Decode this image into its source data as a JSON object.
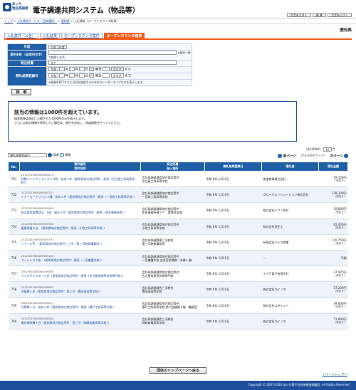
{
  "header": {
    "logo_text_1": "あいち",
    "logo_text_2": "物品等調達",
    "title": "電子調達共同システム（物品等）",
    "font_buttons": [
      "文字を大きく",
      "標 準",
      "文字を小さく"
    ]
  },
  "breadcrumb": {
    "items": [
      "トップ",
      "入札情報サービス（団体選択）",
      "愛知県"
    ],
    "current": "入札情報（オープンカウンタ結果）"
  },
  "prefecture": "愛知県",
  "tabs": [
    "入札案件（公告）",
    "入札結果",
    "オープンカウンタ案件",
    "オープンカウンタ結果"
  ],
  "form": {
    "year_label": "年度",
    "year_value": "令和 5年度",
    "subject_label": "案件名称\n（全角50文字）",
    "subject_note": "※部分一致で検索します。",
    "division_label": "発注所属",
    "division_value": "全て",
    "date_label": "開札結果登録日",
    "date_era": "令和",
    "date_year": "年",
    "date_month": "月",
    "date_day": "日",
    "weekday": "曜日",
    "clear": "クリア",
    "from": "から",
    "to": "まで",
    "date_note": "※画像を押下すると日付を指定するためのカレンダーダイアログを表示します。"
  },
  "search_button": "検　索",
  "message": {
    "title": "該当の情報は1000件を超えています。",
    "line1": "検索結果は直近に公開された1000件のみを表示します。",
    "line2": "さらに以前の情報を参照したい場合は、条件を追加し、再度検索を行ってください。"
  },
  "results": {
    "count_text": "（全1000件）",
    "per_page_value": "10",
    "per_page_suffix": "件",
    "sort_value": "開札結果登録日",
    "asc": "昇順",
    "desc": "降順",
    "prev": "前ページ",
    "page_info": "（76/100ページ）",
    "next": "次ページ",
    "headers": {
      "no": "No.",
      "subject_top": "案件番号",
      "subject_bottom": "案件名称",
      "division_top": "発注所属",
      "division_bottom": "納入場所",
      "date": "開札結果登録日",
      "winner": "落札者",
      "amount": "落札金額"
    },
    "rows": [
      {
        "no": "751",
        "number": "23122523000000005410",
        "name": "同胞バンドアッセンブリ 1個　始め４件（愛知県地方物品等件（尾張（名古屋工科高等学校）〉",
        "division": "会計局調達課県地方物品等件",
        "place": "名古屋工科高等学校",
        "date": "令和 6年 1月10日",
        "winner": "愛進商事株式会社",
        "amount": "19,100円",
        "tax": "（税抜き）"
      },
      {
        "no": "752",
        "number": "23122523000000005221",
        "name": "トナーカートリッジ３種　始め２件（愛知県地方物品等件（尾張（一宮航工科高等学校）〉",
        "division": "会計局調達課県地方物品等件",
        "place": "一宮航工科高等学校",
        "date": "令和 6年 1月10日",
        "winner": "グローバルソリューション株式会社",
        "amount": "129,300円",
        "tax": "（税抜き）"
      },
      {
        "no": "753",
        "number": "23122523000000005454",
        "name": "純水製造装置部品　1個　始め２件（愛知県地方物品等件（尾張（知多事務所等）〉",
        "division": "会計局調達課県地方物品等件",
        "place": "知多事務所棟２Ｆ　環境保全課",
        "date": "令和 6年 1月10日",
        "winner": "株式会社テクノ西村",
        "amount": "39,800円",
        "tax": "（税抜き）"
      },
      {
        "no": "754",
        "number": "23122523000000005944",
        "name": "複層擦器８台　（愛知県地方物品等件：尾張（小牧工科高等学校）〉",
        "division": "会計局調達課県地方物品等件",
        "place": "小牧工科高等学校",
        "date": "令和 6年 1月10日",
        "winner": "株式会社羽生工",
        "amount": "62,400円",
        "tax": "（税抜き）"
      },
      {
        "no": "755",
        "number": "23122323000000005191",
        "name": "トナー５色　〈愛知県地方物品等件：三河（東三河総務事務所）〉",
        "division": "会計局調達課東三河総合",
        "place": "東三河総務事務所",
        "date": "令和 6年 1月10日",
        "winner": "有限会社エテカ商事",
        "amount": "170,750円",
        "tax": "（税抜き）"
      },
      {
        "no": "756",
        "number": "23122223000000005160",
        "name": "マットレス４枚　〈愛知県地方物品等件：尾張（一宮養護学校）〉",
        "division": "会計局調達課県地方物品等件",
        "place": "一宮養護学校\n会合室前通路（本棟１階）",
        "date": "令和 6年 1月10日",
        "winner": "―",
        "amount": "不調",
        "tax": ""
      },
      {
        "no": "757",
        "number": "24010923000000006065",
        "name": "アナログテスター５台〈愛知県地方物品等件：尾張（名古屋南高等技術専門校）〉",
        "division": "会計局調達課県地方物品等件",
        "place": "名古屋南高等技術専門校",
        "date": "令和 6年 1月10日",
        "winner": "テクサ電子有限会社",
        "amount": "37,975円",
        "tax": "（税抜き）"
      },
      {
        "no": "758",
        "number": "23122023000000006497",
        "name": "冷蔵庫１台〈愛知県地方物品等件：西三河（豊田東高等学校）〉",
        "division": "会計局調達課西三河総合",
        "place": "豊田東高等学校",
        "date": "令和 6年 1月10日",
        "winner": "株式会社カイノス",
        "amount": "57,200円",
        "tax": "（税抜き）"
      },
      {
        "no": "759",
        "number": "24010923000000006019",
        "name": "冷蔵庫１台　始め２件〈愛知県地方物品等件：尾張（瀬戸工科高等学校）〉",
        "division": "会計局調達課県地方物品等件",
        "place": "瀬戸工科高等学校\n第二会議棟１階　職員室",
        "date": "令和 6年 1月10日",
        "winner": "株式会社ユタイジー",
        "amount": "39,400円",
        "tax": "（税抜き）"
      },
      {
        "no": "760",
        "number": "23122723000000006293",
        "name": "電気掃除機１台〈愛知県地方物品等件：西三河（岡崎商業高等学校）〉",
        "division": "会計局調達課西三河総合",
        "place": "岡崎商業高等学校",
        "date": "令和 6年 1月10日",
        "winner": "株式会社カイノス",
        "amount": "71,800円",
        "tax": "（税抜き）"
      }
    ]
  },
  "top_button": "団体のトップページへ戻る",
  "page_top": "↑ページトップへ",
  "footer": "Copyright © 2007-2024 あいち電子自治体推進協議会. All Rights Reserved."
}
